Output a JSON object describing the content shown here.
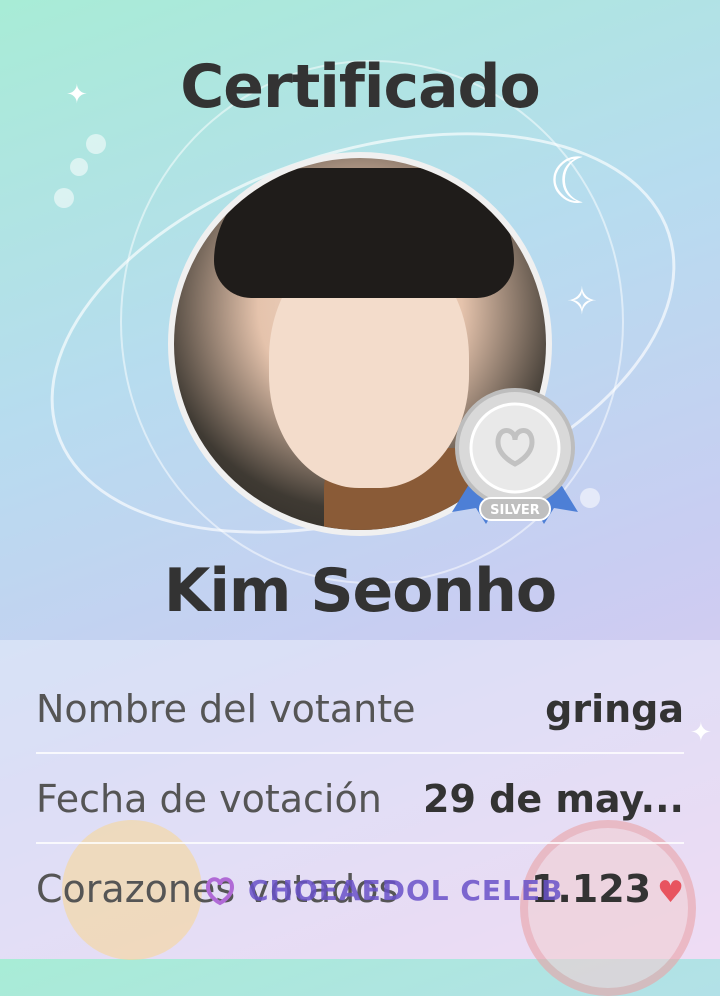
{
  "certificate": {
    "title": "Certificado",
    "celebrity_name": "Kim Seonho",
    "badge_label": "SILVER",
    "badge_color": "#c9c9c9",
    "rows": [
      {
        "label": "Nombre del votante",
        "value": "gringa"
      },
      {
        "label": "Fecha de votación",
        "value": "29 de may..."
      },
      {
        "label": "Corazones votados",
        "value": "1.123"
      }
    ],
    "heart_icon": "heart-icon",
    "brand_logo": "CHOEAEDOL CELEB"
  },
  "colors": {
    "title_text": "#333333",
    "heart": "#e8545f",
    "brand": "#6a52c9"
  }
}
